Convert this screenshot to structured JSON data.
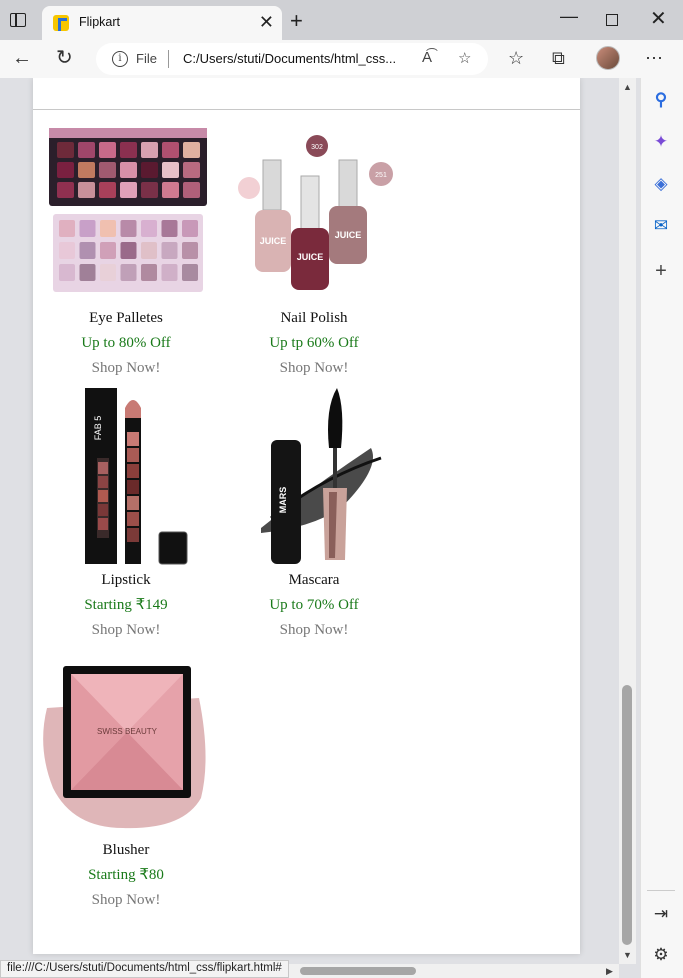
{
  "browser": {
    "tab_title": "Flipkart",
    "tab_close": "✕",
    "new_tab": "+",
    "address_file": "File",
    "address_url": "C:/Users/stuti/Documents/html_css...",
    "status_url": "file:///C:/Users/stuti/Documents/html_css/flipkart.html#"
  },
  "icons": {
    "back": "←",
    "reload": "↻",
    "read_aloud": "A͡",
    "favorite_add": "☆",
    "favorites": "☆",
    "collections": "⧉",
    "more": "⋯",
    "minimize": "—",
    "close": "✕",
    "search": "⚲",
    "copilot": "✦",
    "office": "◈",
    "outlook": "✉",
    "add": "+",
    "split": "⇥",
    "settings": "⚙"
  },
  "products": [
    {
      "name": "Eye Palletes",
      "offer": "Up to 80% Off",
      "shop": "Shop Now!"
    },
    {
      "name": "Nail Polish",
      "offer": "Up tp 60% Off",
      "shop": "Shop Now!"
    },
    {
      "name": "Lipstick",
      "offer": "Starting ₹149",
      "shop": "Shop Now!"
    },
    {
      "name": "Mascara",
      "offer": "Up to 70% Off",
      "shop": "Shop Now!"
    },
    {
      "name": "Blusher",
      "offer": "Starting ₹80",
      "shop": "Shop Now!"
    }
  ],
  "product_labels": {
    "nail_polish_brand": "JUICE",
    "nail_polish_shades": [
      "302",
      "251"
    ],
    "lipstick_brand": "FAB 5",
    "mascara_brand": "MARS",
    "blusher_brand": "SWISS BEAUTY"
  },
  "colors": {
    "offer_green": "#1a7a1a",
    "shop_gray": "#777777",
    "flipkart_yellow": "#f7c600",
    "flipkart_blue": "#2a6fd6"
  }
}
